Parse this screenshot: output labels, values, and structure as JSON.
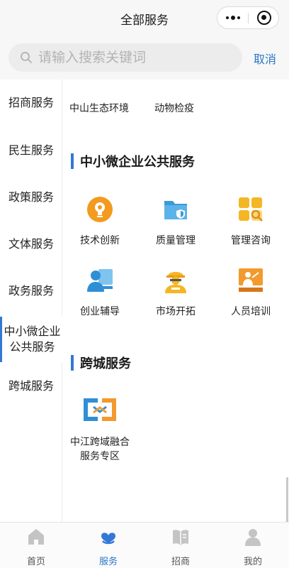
{
  "window": {
    "title": "全部服务",
    "more_icon": "more-dots-icon",
    "close_icon": "close-miniprogram-icon"
  },
  "search": {
    "placeholder": "请输入搜索关键词",
    "value": "",
    "cancel_label": "取消"
  },
  "sidebar": {
    "items": [
      {
        "label": "招商服务"
      },
      {
        "label": "民生服务"
      },
      {
        "label": "政策服务"
      },
      {
        "label": "文体服务"
      },
      {
        "label": "政务服务"
      },
      {
        "label": "中小微企业公共服务",
        "active": true
      },
      {
        "label": "跨城服务"
      }
    ]
  },
  "content": {
    "top_links": [
      "中山生态环境",
      "动物检疫"
    ],
    "sections": [
      {
        "title": "中小微企业公共服务",
        "tiles": [
          {
            "label": "技术创新",
            "icon": "lightbulb-head-icon"
          },
          {
            "label": "质量管理",
            "icon": "shield-folder-icon"
          },
          {
            "label": "管理咨询",
            "icon": "grid-search-icon"
          },
          {
            "label": "创业辅导",
            "icon": "mentor-person-icon"
          },
          {
            "label": "市场开拓",
            "icon": "worker-helmet-icon"
          },
          {
            "label": "人员培训",
            "icon": "training-presenter-icon"
          }
        ]
      },
      {
        "title": "跨城服务",
        "tiles": [
          {
            "label": "中江跨域融合服务专区",
            "icon": "cross-city-icon"
          }
        ]
      }
    ]
  },
  "tabbar": {
    "tabs": [
      {
        "label": "首页",
        "icon": "home-icon"
      },
      {
        "label": "服务",
        "icon": "service-heart-icon",
        "active": true
      },
      {
        "label": "招商",
        "icon": "investment-book-icon"
      },
      {
        "label": "我的",
        "icon": "user-icon"
      }
    ]
  },
  "colors": {
    "accent": "#3478d6",
    "link_blue": "#2a76c8",
    "icon_orange": "#f39a1f",
    "icon_blue": "#3c9ad8"
  }
}
